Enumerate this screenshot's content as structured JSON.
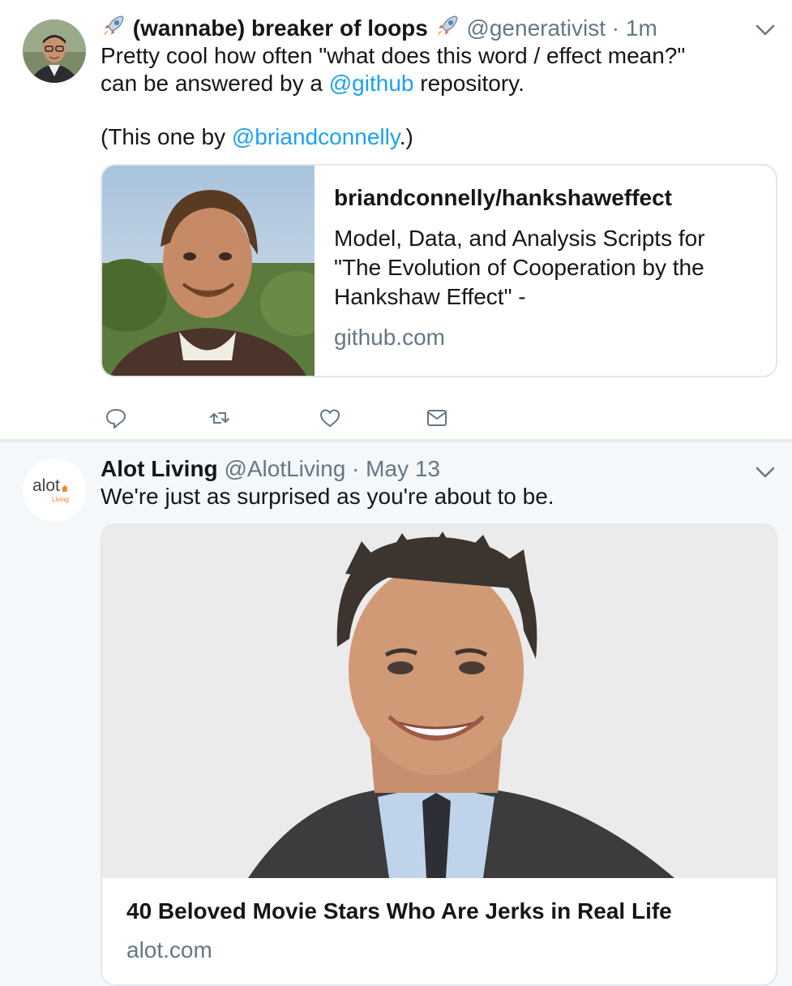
{
  "tweet1": {
    "name": "(wannabe) breaker of loops",
    "handle": "@generativist",
    "dot": " · ",
    "time": "1m",
    "line1": "Pretty cool how often \"what does this word / effect mean?\"",
    "line2_pre": "can be answered by a ",
    "line2_link": "@github",
    "line2_post": " repository.",
    "line3_pre": "(This one by ",
    "line3_link": "@briandconnelly",
    "line3_post": ".)",
    "card": {
      "title": "briandconnelly/hankshaweffect",
      "description": "Model, Data, and Analysis Scripts for \"The Evolution of Cooperation by the Hankshaw Effect\" -",
      "domain": "github.com"
    },
    "actions": [
      "reply-icon",
      "retweet-icon",
      "like-icon",
      "message-icon"
    ]
  },
  "tweet2": {
    "name": "Alot Living",
    "handle": "@AlotLiving",
    "dot": " · ",
    "time": "May 13",
    "text": "We're just as surprised as you're about to be.",
    "avatar_logo": "alot",
    "avatar_sub": "Living",
    "card": {
      "title": "40 Beloved Movie Stars Who Are Jerks in Real Life",
      "domain": "alot.com"
    }
  },
  "colors": {
    "link": "#1da1f2",
    "muted": "#657786",
    "border": "#e1e8ed",
    "alot_orange": "#f5821f"
  }
}
